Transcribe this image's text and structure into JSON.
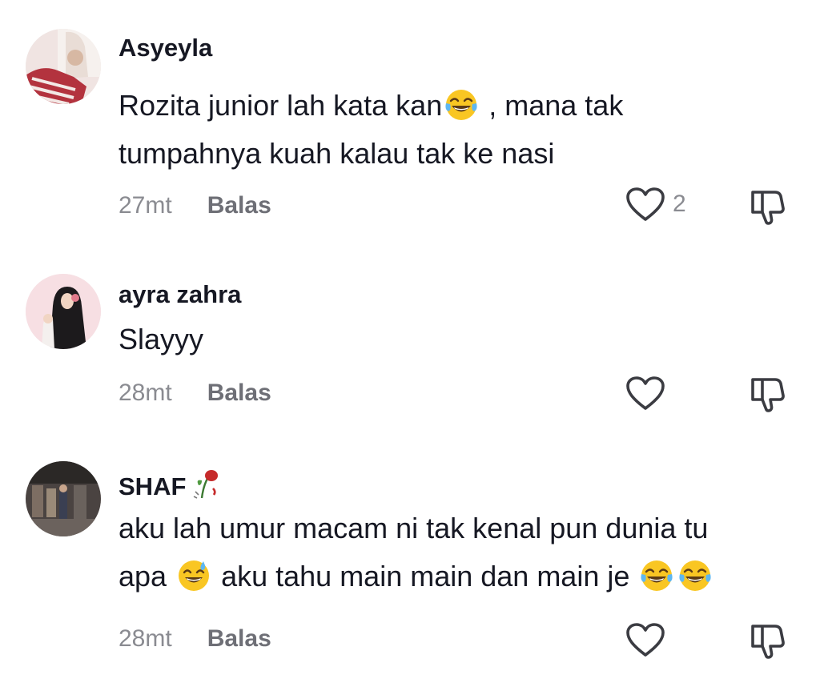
{
  "comments": [
    {
      "username": "Asyeyla",
      "text_line1_a": "Rozita junior lah kata kan",
      "text_line1_b": " , mana tak",
      "text_line2": "tumpahnya kuah kalau tak ke nasi",
      "time": "27mt",
      "reply_label": "Balas",
      "like_count": "2",
      "emojis": [
        "tears-of-joy"
      ]
    },
    {
      "username": "ayra zahra",
      "text_line1": "Slayyy",
      "time": "28mt",
      "reply_label": "Balas",
      "like_count": ""
    },
    {
      "username": "SHAF",
      "username_emoji": "wilted-rose",
      "text_line1": "aku lah umur macam ni tak kenal pun dunia tu",
      "text_line2_a": "apa ",
      "text_line2_b": " aku tahu main main dan main je ",
      "time": "28mt",
      "reply_label": "Balas",
      "like_count": "",
      "emojis": [
        "sweat-smile",
        "tears-of-joy",
        "tears-of-joy"
      ]
    }
  ],
  "icons": {
    "like": "heart-outline-icon",
    "dislike": "thumbs-down-icon"
  },
  "colors": {
    "text": "#161823",
    "meta": "#8a8b91",
    "icon": "#3b3c42"
  }
}
